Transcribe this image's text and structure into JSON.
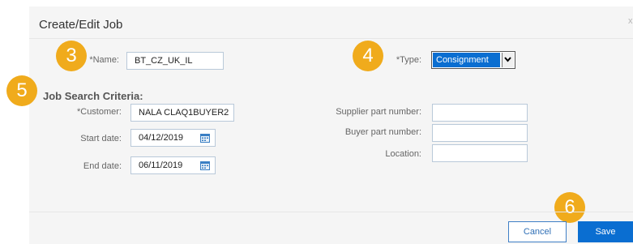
{
  "dialog": {
    "title": "Create/Edit Job",
    "close_symbol": "x"
  },
  "badges": [
    "3",
    "4",
    "5",
    "6"
  ],
  "job": {
    "name_label": "*Name:",
    "name_value": "BT_CZ_UK_IL",
    "type_label": "*Type:",
    "type_value": "Consignment"
  },
  "search": {
    "title": "Job Search Criteria:",
    "customer_label": "*Customer:",
    "customer_value": "NALA CLAQ1BUYER2",
    "start_label": "Start date:",
    "start_value": "04/12/2019",
    "end_label": "End date:",
    "end_value": "06/11/2019",
    "supplier_part_label": "Supplier part number:",
    "supplier_part_value": "",
    "buyer_part_label": "Buyer part number:",
    "buyer_part_value": "",
    "location_label": "Location:",
    "location_value": ""
  },
  "footer": {
    "cancel_label": "Cancel",
    "save_label": "Save"
  },
  "colors": {
    "badge": "#f0ab1c",
    "primary": "#0a6ed1",
    "field_border": "#b9c9d9"
  }
}
